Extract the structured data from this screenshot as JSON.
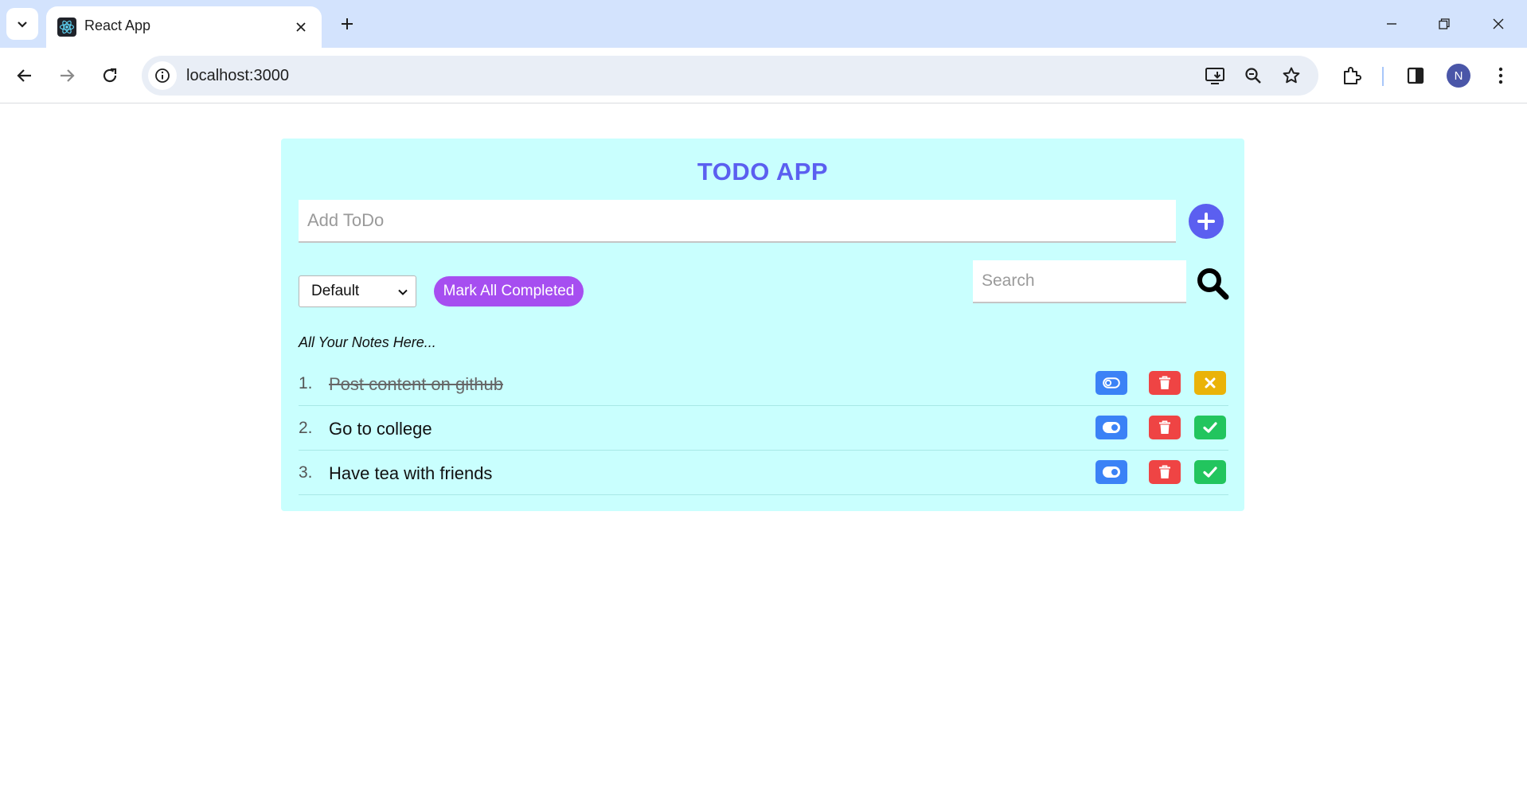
{
  "browser": {
    "tab_title": "React App",
    "url": "localhost:3000",
    "profile_initial": "N",
    "icons": [
      "tab-search-icon",
      "react-favicon-icon",
      "close-icon",
      "plus-icon",
      "minimize-icon",
      "restore-icon",
      "window-close-icon",
      "back-arrow-icon",
      "forward-arrow-icon",
      "reload-icon",
      "site-info-icon",
      "install-app-icon",
      "zoom-icon",
      "bookmark-star-icon",
      "extensions-icon",
      "side-panel-icon",
      "more-vert-icon"
    ]
  },
  "app": {
    "title": "TODO APP",
    "add_placeholder": "Add ToDo",
    "filter_selected": "Default",
    "mark_all_label": "Mark All Completed",
    "search_placeholder": "Search",
    "notes_caption": "All Your Notes Here...",
    "colors": {
      "card_bg": "#c9fffe",
      "title": "#5b5ff0",
      "mark_all": "#a64ef0",
      "toggle": "#3b82f6",
      "delete": "#ef4444",
      "undo": "#eab308",
      "complete": "#22c55e"
    },
    "todos": [
      {
        "number": "1.",
        "text": "Post content on github",
        "completed": true,
        "toggle_state": "off"
      },
      {
        "number": "2.",
        "text": "Go to college",
        "completed": false,
        "toggle_state": "on"
      },
      {
        "number": "3.",
        "text": "Have tea with friends",
        "completed": false,
        "toggle_state": "on"
      }
    ]
  }
}
